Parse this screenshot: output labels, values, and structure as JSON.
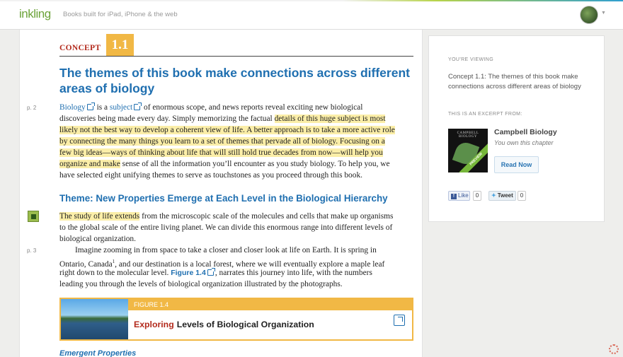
{
  "header": {
    "logo": "inkling",
    "tagline": "Books built for iPad, iPhone & the web"
  },
  "article": {
    "concept_label": "CONCEPT",
    "concept_number": "1.1",
    "title_line1": "The themes of this book make connections across different",
    "title_line2": "areas of biology",
    "page_markers": [
      "p. 2",
      "p. 3"
    ],
    "para1": {
      "l1_link1": "Biology",
      "l1_mid": " is a ",
      "l1_link2": "subject",
      "l1_rest": " of enormous scope, and news reports reveal exciting new biological",
      "l2_plain": "discoveries being made every day. Simply memorizing the factual ",
      "l2_hl": "details of this huge subject is most",
      "l3_hl": "likely not the best way to develop a coherent view of life. A better approach is to take a more active role",
      "l4_hl": "by connecting the many things you learn to a set of themes that pervade all of biology. Focusing on a",
      "l5_hl": "few big ideas—ways of thinking about life that will still hold true decades from now—will help you",
      "l6_hl": "organize and make",
      "l6_rest": " sense of all the information you’ll encounter as you study biology. To help you, we",
      "l7": "have selected eight unifying themes to serve as touchstones as you proceed through this book."
    },
    "theme_heading": "Theme: New Properties Emerge at Each Level in the Biological Hierarchy",
    "para2": {
      "l1_hl": "The study of life extends",
      "l1_rest": " from the microscopic scale of the molecules and cells that make up organisms",
      "l2": "to the global scale of the entire living planet. We can divide this enormous range into different levels of",
      "l3": "biological organization."
    },
    "para3": {
      "l1": "Imagine zooming in from space to take a closer and closer look at life on Earth. It is spring in",
      "l2_a": "Ontario, Canada",
      "l2_sup": "1",
      "l2_b": ", and our destination is a local forest, where we will eventually explore a maple leaf",
      "l3_a": "right down to the molecular level. ",
      "l3_link": "Figure 1.4",
      "l3_b": ", narrates this journey into life, with the numbers",
      "l4": "leading you through the levels of biological organization illustrated by the photographs."
    },
    "figure": {
      "label": "FIGURE 1.4",
      "exploring": "Exploring",
      "title": "Levels of Biological Organization"
    },
    "emergent_heading": "Emergent Properties"
  },
  "sidebar": {
    "viewing_label": "YOU'RE VIEWING",
    "viewing_text": "Concept 1.1: The themes of this book make connections across different areas of biology",
    "excerpt_label": "THIS IS AN EXCERPT FROM:",
    "cover_text": "CAMPBELL BIOLOGY",
    "cover_ribbon": "PREVIEW",
    "book_title": "Campbell Biology",
    "ownership": "You own this chapter",
    "read_button": "Read Now",
    "like_label": "Like",
    "like_count": "0",
    "tweet_label": "Tweet",
    "tweet_count": "0"
  },
  "colors": {
    "link_blue": "#1f6fb0",
    "concept_red": "#b32a1c",
    "accent_gold": "#f1b845",
    "highlight": "#fbeea8"
  }
}
